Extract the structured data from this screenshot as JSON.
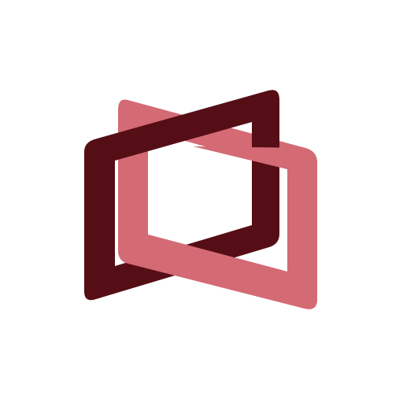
{
  "logo": {
    "icon": "interlocking-parallelograms-logo",
    "colors": {
      "background": "#ffffff",
      "dark_frame": "#560E16",
      "light_frame": "#D46A74"
    }
  }
}
